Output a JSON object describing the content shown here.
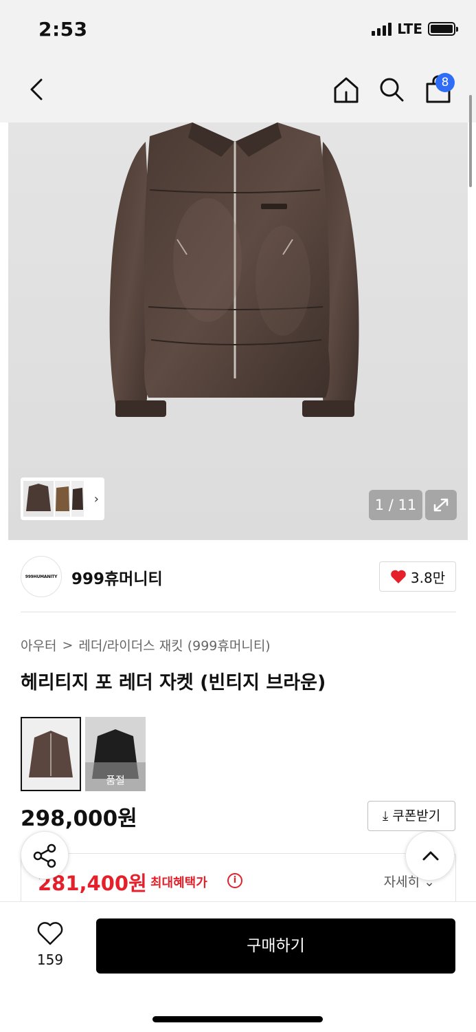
{
  "status_bar": {
    "time": "2:53",
    "network": "LTE"
  },
  "nav": {
    "cart_count": "8",
    "icons": [
      "back-chevron-icon",
      "home-icon",
      "search-icon",
      "shopping-bag-icon"
    ]
  },
  "gallery": {
    "page_current": "1",
    "page_separator": "/",
    "page_total": "11",
    "page_indicator": "1 / 11"
  },
  "brand": {
    "logo_text": "999HUMANITY",
    "name": "999휴머니티",
    "likes": "3.8만"
  },
  "breadcrumb": {
    "level1": "아우터",
    "separator": ">",
    "level2": "레더/라이더스 재킷 (999휴머니티)"
  },
  "product": {
    "title": "헤리티지 포 레더 자켓 (빈티지 브라운)",
    "color_options": [
      {
        "name": "brown",
        "selected": true,
        "sold_out": false
      },
      {
        "name": "black",
        "selected": false,
        "sold_out": true,
        "badge": "품절"
      }
    ],
    "price": "298,000원",
    "coupon_label": "쿠폰받기",
    "benefit_price": "281,400원",
    "benefit_label": "최대혜택가",
    "detail_label": "자세히"
  },
  "bottom_bar": {
    "wish_count": "159",
    "buy_label": "구매하기"
  },
  "colors": {
    "accent_red": "#e4202a",
    "badge_blue": "#2f6df6",
    "buy_button": "#000000"
  }
}
